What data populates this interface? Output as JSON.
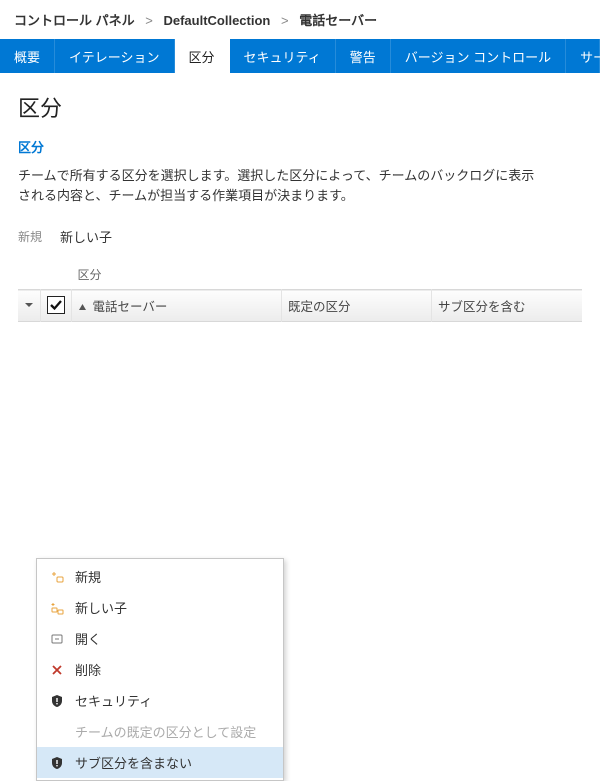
{
  "breadcrumb": {
    "items": [
      "コントロール パネル",
      "DefaultCollection",
      "電話セーバー"
    ]
  },
  "tabs": {
    "items": [
      {
        "label": "概要"
      },
      {
        "label": "イテレーション"
      },
      {
        "label": "区分"
      },
      {
        "label": "セキュリティ"
      },
      {
        "label": "警告"
      },
      {
        "label": "バージョン コントロール"
      },
      {
        "label": "サービス..."
      }
    ],
    "active_index": 2
  },
  "page": {
    "title": "区分",
    "section_link": "区分",
    "description": "チームで所有する区分を選択します。選択した区分によって、チームのバックログに表示される内容と、チームが担当する作業項目が決まります。"
  },
  "toolbar": {
    "new_label": "新規",
    "new_child_label": "新しい子"
  },
  "table": {
    "top_header": {
      "area": "区分"
    },
    "columns": {
      "name": "電話セーバー",
      "default": "既定の区分",
      "include": "サブ区分を含む"
    },
    "row": {
      "checked": true
    }
  },
  "context_menu": {
    "items": [
      {
        "label": "新規",
        "icon": "sparkle-new",
        "disabled": false
      },
      {
        "label": "新しい子",
        "icon": "sparkle-child",
        "disabled": false
      },
      {
        "label": "開く",
        "icon": "open",
        "disabled": false
      },
      {
        "label": "削除",
        "icon": "delete-x",
        "disabled": false
      },
      {
        "label": "セキュリティ",
        "icon": "shield-alert",
        "disabled": false
      },
      {
        "label": "チームの既定の区分として設定",
        "icon": "none",
        "disabled": true
      },
      {
        "label": "サブ区分を含まない",
        "icon": "shield-alert",
        "disabled": false,
        "highlight": true
      }
    ]
  }
}
